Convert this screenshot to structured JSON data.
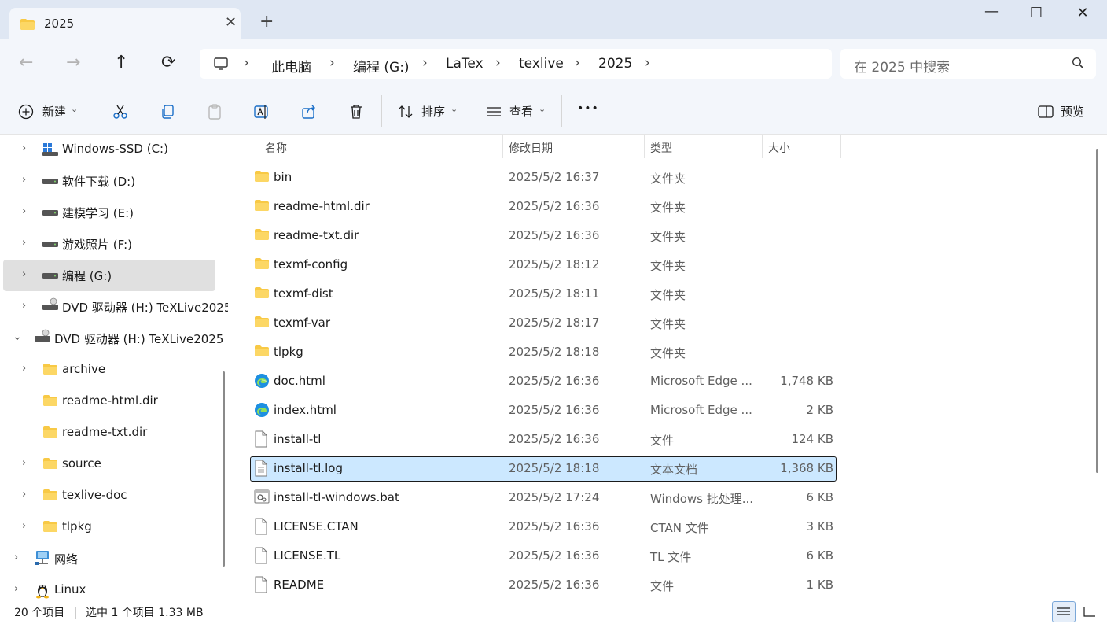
{
  "tab": {
    "title": "2025",
    "close": "✕",
    "new": "+"
  },
  "window": {
    "minimize": "—",
    "maximize": "☐",
    "close": "✕"
  },
  "nav": {
    "back": "←",
    "forward": "→",
    "up": "↑",
    "refresh": "⟳"
  },
  "breadcrumb": [
    "此电脑",
    "编程 (G:)",
    "LaTex",
    "texlive",
    "2025"
  ],
  "search": {
    "placeholder": "在 2025 中搜索"
  },
  "toolbar": {
    "new_label": "新建",
    "sort_label": "排序",
    "view_label": "查看",
    "more_label": "•••",
    "preview_label": "预览"
  },
  "sidebar": {
    "items": [
      {
        "label": "Windows-SSD (C:)",
        "icon": "drive-windows-icon",
        "expandable": true
      },
      {
        "label": "软件下载 (D:)",
        "icon": "drive-icon",
        "expandable": true
      },
      {
        "label": "建模学习 (E:)",
        "icon": "drive-icon",
        "expandable": true
      },
      {
        "label": "游戏照片 (F:)",
        "icon": "drive-icon",
        "expandable": true
      },
      {
        "label": "编程 (G:)",
        "icon": "drive-icon",
        "expandable": true,
        "selected": true
      },
      {
        "label": "DVD 驱动器 (H:) TeXLive2025",
        "icon": "dvd-icon",
        "expandable": true
      },
      {
        "label": "DVD 驱动器 (H:) TeXLive2025",
        "icon": "dvd-icon",
        "expanded": true
      },
      {
        "label": "archive",
        "icon": "folder-icon",
        "expandable": true
      },
      {
        "label": "readme-html.dir",
        "icon": "folder-icon",
        "expandable": false
      },
      {
        "label": "readme-txt.dir",
        "icon": "folder-icon",
        "expandable": false
      },
      {
        "label": "source",
        "icon": "folder-icon",
        "expandable": true
      },
      {
        "label": "texlive-doc",
        "icon": "folder-icon",
        "expandable": true
      },
      {
        "label": "tlpkg",
        "icon": "folder-icon",
        "expandable": true
      },
      {
        "label": "网络",
        "icon": "network-icon",
        "expandable": true
      },
      {
        "label": "Linux",
        "icon": "linux-icon",
        "expandable": true
      }
    ]
  },
  "columns": {
    "name": "名称",
    "modified": "修改日期",
    "type": "类型",
    "size": "大小"
  },
  "files": [
    {
      "name": "bin",
      "date": "2025/5/2 16:37",
      "type": "文件夹",
      "size": "",
      "icon": "folder-icon"
    },
    {
      "name": "readme-html.dir",
      "date": "2025/5/2 16:36",
      "type": "文件夹",
      "size": "",
      "icon": "folder-icon"
    },
    {
      "name": "readme-txt.dir",
      "date": "2025/5/2 16:36",
      "type": "文件夹",
      "size": "",
      "icon": "folder-icon"
    },
    {
      "name": "texmf-config",
      "date": "2025/5/2 18:12",
      "type": "文件夹",
      "size": "",
      "icon": "folder-icon"
    },
    {
      "name": "texmf-dist",
      "date": "2025/5/2 18:11",
      "type": "文件夹",
      "size": "",
      "icon": "folder-icon"
    },
    {
      "name": "texmf-var",
      "date": "2025/5/2 18:17",
      "type": "文件夹",
      "size": "",
      "icon": "folder-icon"
    },
    {
      "name": "tlpkg",
      "date": "2025/5/2 18:18",
      "type": "文件夹",
      "size": "",
      "icon": "folder-icon"
    },
    {
      "name": "doc.html",
      "date": "2025/5/2 16:36",
      "type": "Microsoft Edge ...",
      "size": "1,748 KB",
      "icon": "edge-icon"
    },
    {
      "name": "index.html",
      "date": "2025/5/2 16:36",
      "type": "Microsoft Edge ...",
      "size": "2 KB",
      "icon": "edge-icon"
    },
    {
      "name": "install-tl",
      "date": "2025/5/2 16:36",
      "type": "文件",
      "size": "124 KB",
      "icon": "file-icon"
    },
    {
      "name": "install-tl.log",
      "date": "2025/5/2 18:18",
      "type": "文本文档",
      "size": "1,368 KB",
      "icon": "text-file-icon",
      "selected": true
    },
    {
      "name": "install-tl-windows.bat",
      "date": "2025/5/2 17:24",
      "type": "Windows 批处理...",
      "size": "6 KB",
      "icon": "batch-file-icon"
    },
    {
      "name": "LICENSE.CTAN",
      "date": "2025/5/2 16:36",
      "type": "CTAN 文件",
      "size": "3 KB",
      "icon": "file-icon"
    },
    {
      "name": "LICENSE.TL",
      "date": "2025/5/2 16:36",
      "type": "TL 文件",
      "size": "6 KB",
      "icon": "file-icon"
    },
    {
      "name": "README",
      "date": "2025/5/2 16:36",
      "type": "文件",
      "size": "1 KB",
      "icon": "file-icon"
    }
  ],
  "status": {
    "count": "20 个项目",
    "selection": "选中 1 个项目 1.33 MB"
  },
  "colors": {
    "accent": "#0067c0",
    "selection": "#cce8ff",
    "folder": "#f8c945",
    "edge": "#1d8fe1"
  }
}
